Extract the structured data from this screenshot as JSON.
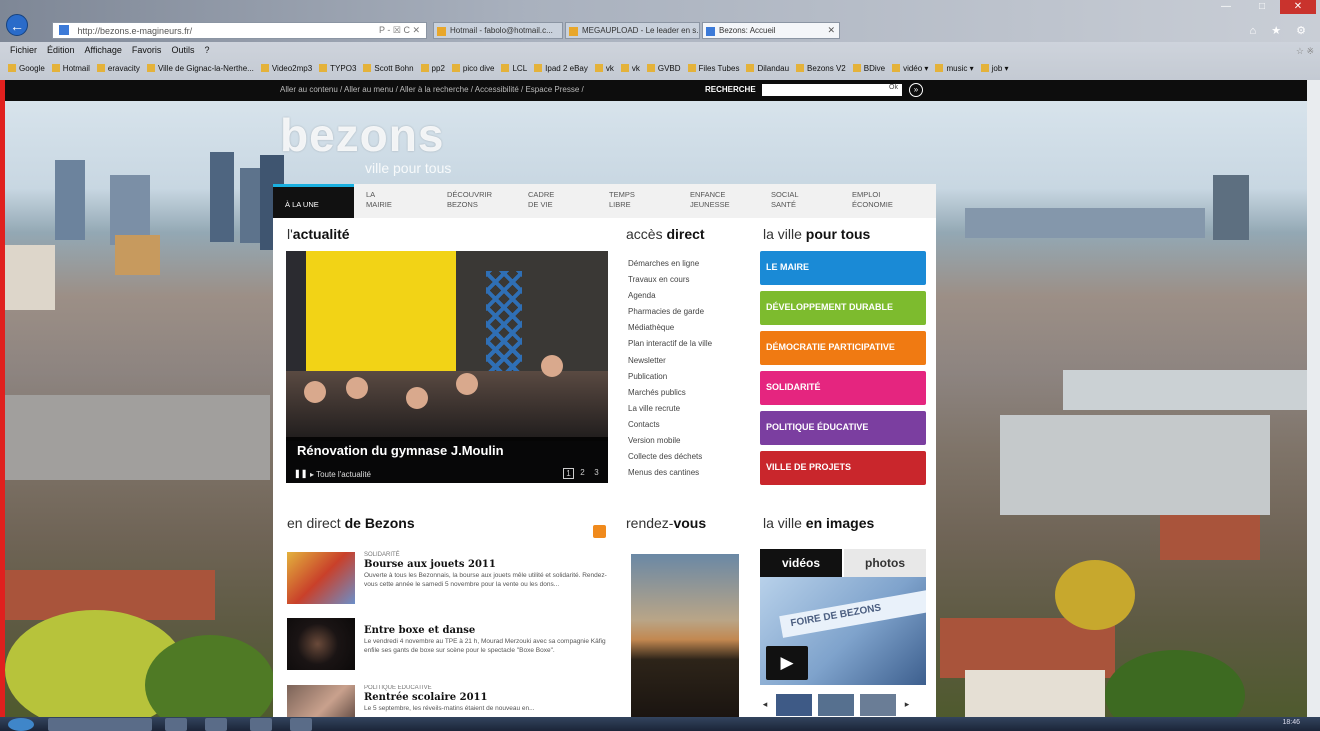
{
  "browser": {
    "url": "http://bezons.e-magineurs.fr/",
    "url_tools": "P - ☒ C ✕",
    "tabs": [
      {
        "label": "Hotmail - fabolo@hotmail.c...",
        "active": false
      },
      {
        "label": "MEGAUPLOAD - Le leader en s...",
        "active": false
      },
      {
        "label": "Bezons: Accueil",
        "active": true
      }
    ],
    "window_controls": [
      "—",
      "□",
      "✕"
    ],
    "home_icons": "⌂ ★ ⚙",
    "menu": [
      "Fichier",
      "Édition",
      "Affichage",
      "Favoris",
      "Outils",
      "?"
    ],
    "side_tools": "☆  ※",
    "favorites": [
      "Google",
      "Hotmail",
      "eravacity",
      "Ville de Gignac-la-Nerthe...",
      "Video2mp3",
      "TYPO3",
      "Scott Bohn",
      "pp2",
      "pico dive",
      "LCL",
      "Ipad 2 eBay",
      "vk",
      "vk",
      "GVBD",
      "Files Tubes",
      "Dilandau",
      "Bezons V2",
      "BDive",
      "vidéo ▾",
      "music ▾",
      "job ▾"
    ]
  },
  "site": {
    "top_links": "Aller au contenu  /  Aller au menu  /  Aller à la recherche  /  Accessibilité  /  Espace Presse  /",
    "search_label": "RECHERCHE",
    "search_value": "Ok",
    "search_go": "»",
    "logo": "bezons",
    "tagline": "ville pour tous",
    "nav": [
      "À LA UNE",
      "LA\nMAIRIE",
      "DÉCOUVRIR\nBEZONS",
      "CADRE\nDE VIE",
      "TEMPS\nLIBRE",
      "ENFANCE\nJEUNESSE",
      "SOCIAL\nSANTÉ",
      "EMPLOI\nÉCONOMIE"
    ],
    "actualite_title_a": "l'",
    "actualite_title_b": "actualité",
    "acces_title_a": "accès ",
    "acces_title_b": "direct",
    "ville_title_a": "la ville ",
    "ville_title_b": "pour tous",
    "hero": {
      "title": "Rénovation du gymnase J.Moulin",
      "pause": "❚❚",
      "all_news": "▸ Toute l'actualité",
      "pages": [
        "1",
        "2",
        "3"
      ]
    },
    "acces_links": [
      "Démarches en ligne",
      "Travaux en cours",
      "Agenda",
      "Pharmacies de garde",
      "Médiathèque",
      "Plan interactif de la ville",
      "Newsletter",
      "Publication",
      "Marchés publics",
      "La ville recrute",
      "Contacts",
      "Version mobile",
      "Collecte des déchets",
      "Menus des cantines"
    ],
    "pills": [
      {
        "label": "LE MAIRE",
        "color": "#1a8ad6"
      },
      {
        "label": "DÉVELOPPEMENT DURABLE",
        "color": "#7dbb2e"
      },
      {
        "label": "DÉMOCRATIE PARTICIPATIVE",
        "color": "#f07a12"
      },
      {
        "label": "SOLIDARITÉ",
        "color": "#e5257f"
      },
      {
        "label": "POLITIQUE ÉDUCATIVE",
        "color": "#7b3ea0"
      },
      {
        "label": "VILLE DE PROJETS",
        "color": "#c9262c"
      }
    ],
    "direct_title_a": "en direct ",
    "direct_title_b": "de Bezons",
    "rdv_title_a": "rendez-",
    "rdv_title_b": "vous",
    "images_title_a": "la ville ",
    "images_title_b": "en images",
    "news": [
      {
        "category": "SOLIDARITÉ",
        "title": "Bourse aux jouets 2011",
        "text": "Ouverte à tous les Bezonnais, la bourse aux jouets mêle utilité et solidarité. Rendez-vous cette année le samedi 5 novembre pour la vente ou les dons..."
      },
      {
        "category": "",
        "title": "Entre boxe et danse",
        "text": "Le vendredi 4 novembre au TPE à 21 h, Mourad Merzouki avec sa compagnie Käfig enfile ses gants de boxe sur scène pour le spectacle \"Boxe Boxe\"."
      },
      {
        "category": "POLITIQUE ÉDUCATIVE",
        "title": "Rentrée scolaire 2011",
        "text": "Le 5 septembre, les réveils-matins étaient de nouveau en..."
      }
    ],
    "media_tabs": [
      "vidéos",
      "photos"
    ],
    "video_band": "FOIRE DE BEZONS",
    "play": "▶",
    "thumb_prev": "◂",
    "thumb_next": "▸"
  },
  "taskbar": {
    "clock": "18:46"
  }
}
